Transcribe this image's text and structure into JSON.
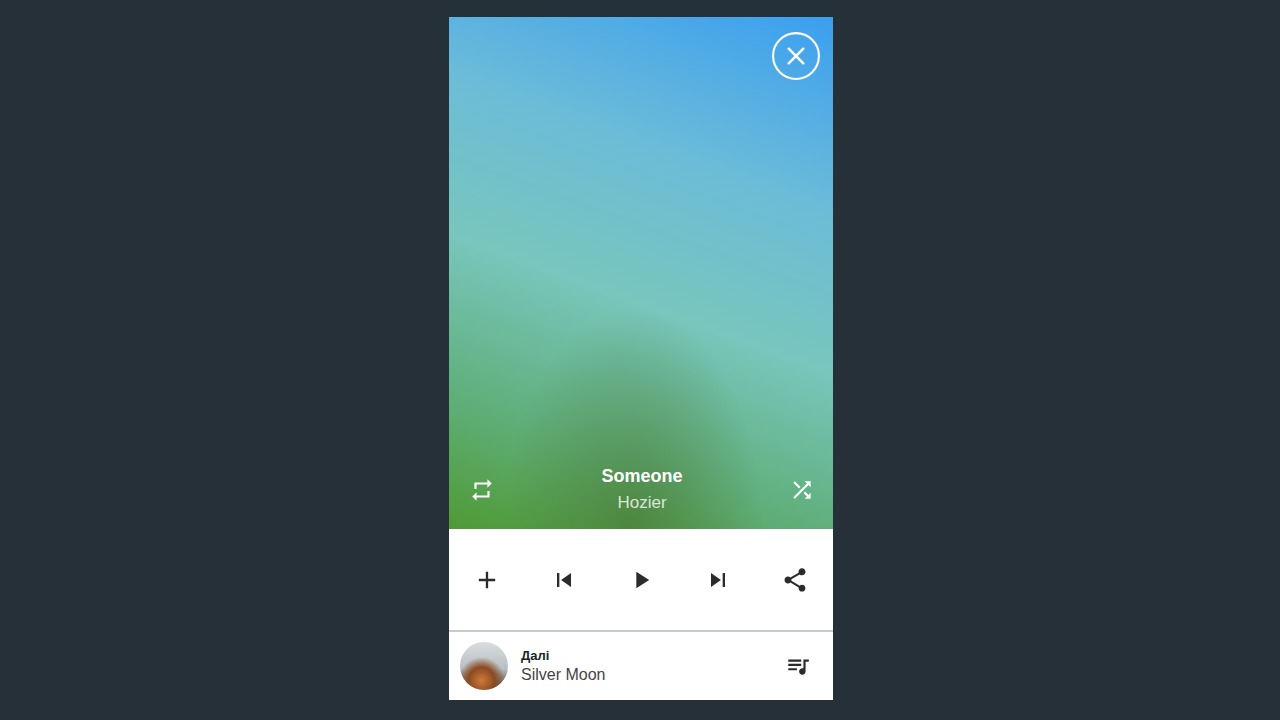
{
  "track": {
    "title": "Someone",
    "artist": "Hozier",
    "playing": false
  },
  "up_next": {
    "label": "Далі",
    "title": "Silver Moon"
  }
}
